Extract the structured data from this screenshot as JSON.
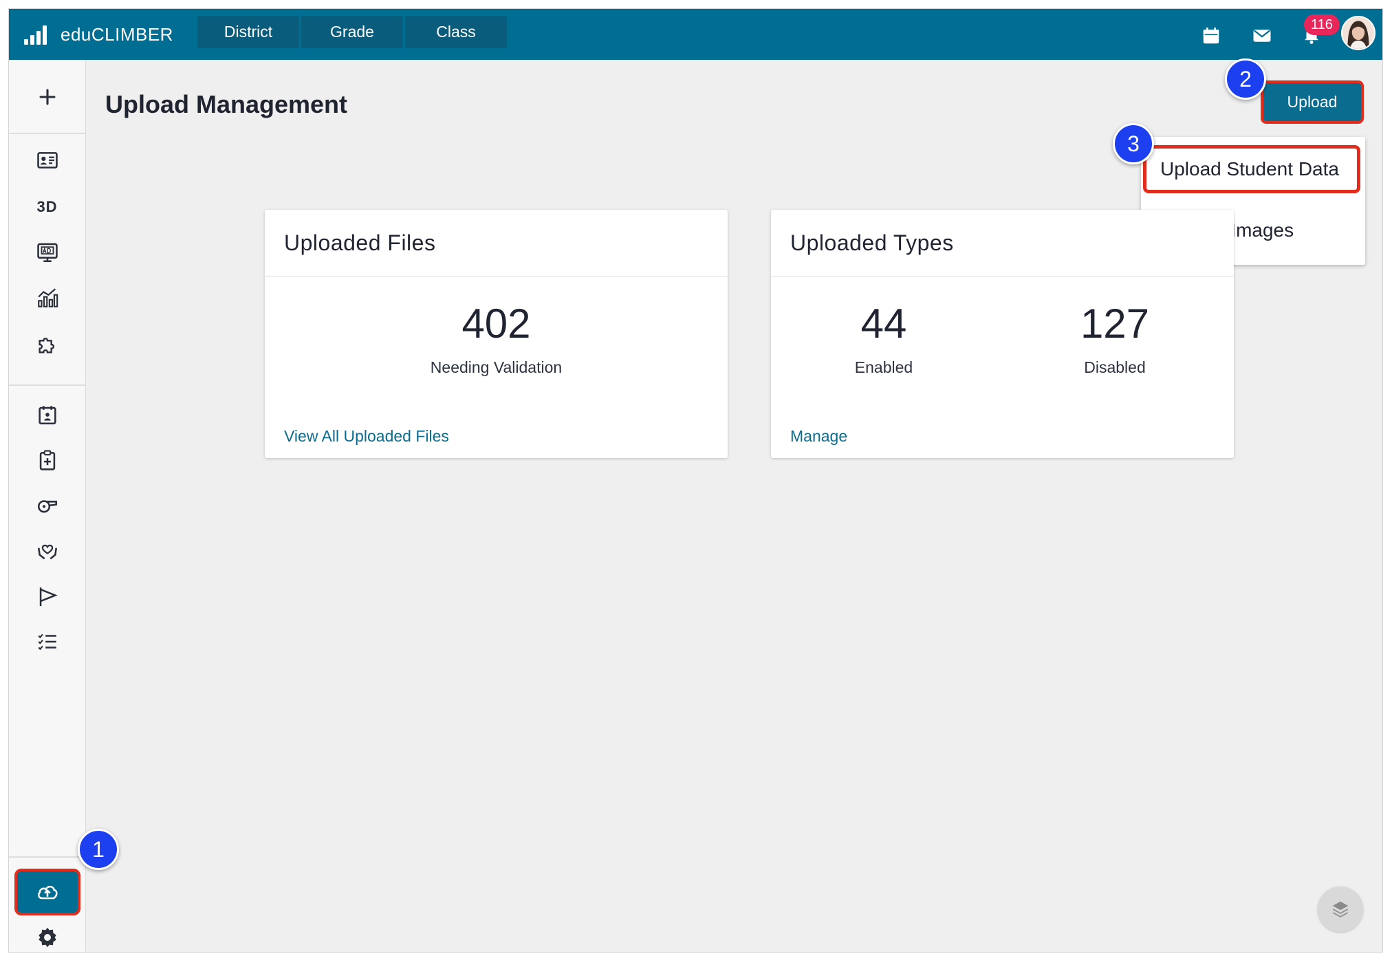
{
  "app": {
    "name": "eduCLIMBER",
    "logo_icon": "bar-chart-logo",
    "brand_color": "#006d93"
  },
  "header": {
    "scope_tabs": [
      {
        "label": "District"
      },
      {
        "label": "Grade"
      },
      {
        "label": "Class"
      }
    ],
    "icons": [
      "calendar-icon",
      "mail-icon",
      "bell-icon"
    ],
    "notification_count": "116"
  },
  "sidebar": {
    "add_icon": "plus-icon",
    "items": [
      {
        "icon": "student-card-icon"
      },
      {
        "label": "3D"
      },
      {
        "icon": "monitor-ad-icon"
      },
      {
        "icon": "analytics-chart-icon"
      },
      {
        "icon": "puzzle-icon"
      },
      {
        "icon": "calendar-person-icon"
      },
      {
        "icon": "clipboard-plus-icon"
      },
      {
        "icon": "whistle-icon"
      },
      {
        "icon": "heart-hands-icon"
      },
      {
        "icon": "flag-icon"
      },
      {
        "icon": "checklist-icon"
      }
    ],
    "upload_icon": "cloud-upload-icon",
    "settings_icon": "gear-icon"
  },
  "main": {
    "title": "Upload Management",
    "upload_button": "Upload",
    "upload_menu": [
      "Upload Student Data",
      "Student Images"
    ]
  },
  "cards": {
    "files": {
      "title": "Uploaded Files",
      "count": "402",
      "count_label": "Needing Validation",
      "link": "View All Uploaded Files"
    },
    "types": {
      "title": "Uploaded Types",
      "enabled_count": "44",
      "enabled_label": "Enabled",
      "disabled_count": "127",
      "disabled_label": "Disabled",
      "link": "Manage"
    }
  },
  "callouts": [
    "1",
    "2",
    "3"
  ],
  "highlight_color": "#e32d1c",
  "callout_color": "#1c3ff0"
}
